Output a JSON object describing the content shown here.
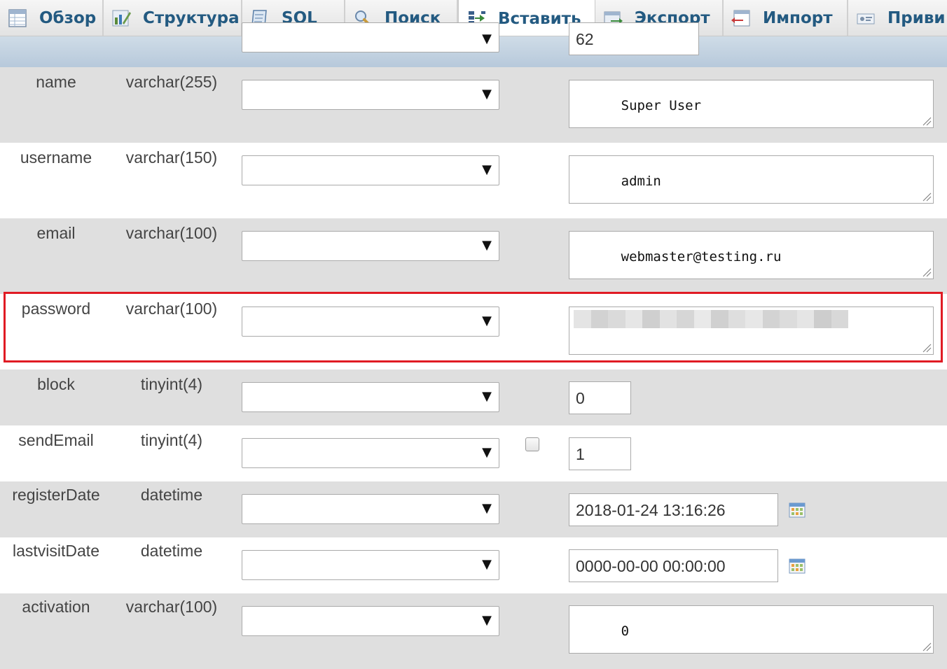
{
  "tabs": [
    {
      "label": "Обзор",
      "icon": "browse-icon"
    },
    {
      "label": "Структура",
      "icon": "structure-icon"
    },
    {
      "label": "SQL",
      "icon": "sql-icon"
    },
    {
      "label": "Поиск",
      "icon": "search-icon"
    },
    {
      "label": "Вставить",
      "icon": "insert-icon",
      "active": true
    },
    {
      "label": "Экспорт",
      "icon": "export-icon"
    },
    {
      "label": "Импорт",
      "icon": "import-icon"
    },
    {
      "label": "Приви",
      "icon": "privileges-icon"
    }
  ],
  "top_row": {
    "value": "62"
  },
  "rows": [
    {
      "name": "name",
      "type": "varchar(255)",
      "function": "",
      "value": "Super User",
      "control": "textarea"
    },
    {
      "name": "username",
      "type": "varchar(150)",
      "function": "",
      "value": "admin",
      "control": "textarea"
    },
    {
      "name": "email",
      "type": "varchar(100)",
      "function": "",
      "value": "webmaster@testing.ru",
      "control": "textarea"
    },
    {
      "name": "password",
      "type": "varchar(100)",
      "function": "",
      "value": "",
      "control": "textarea",
      "blurred": true,
      "highlighted": true
    },
    {
      "name": "block",
      "type": "tinyint(4)",
      "function": "",
      "value": "0",
      "control": "input"
    },
    {
      "name": "sendEmail",
      "type": "tinyint(4)",
      "function": "",
      "value": "1",
      "control": "input",
      "null_checkbox": true
    },
    {
      "name": "registerDate",
      "type": "datetime",
      "function": "",
      "value": "2018-01-24 13:16:26",
      "control": "datetime"
    },
    {
      "name": "lastvisitDate",
      "type": "datetime",
      "function": "",
      "value": "0000-00-00 00:00:00",
      "control": "datetime"
    },
    {
      "name": "activation",
      "type": "varchar(100)",
      "function": "",
      "value": "0",
      "control": "textarea"
    }
  ],
  "colors": {
    "tab_text": "#235a81",
    "row_odd": "#dfdfdf",
    "row_even": "#ffffff",
    "highlight": "#e01b24"
  }
}
